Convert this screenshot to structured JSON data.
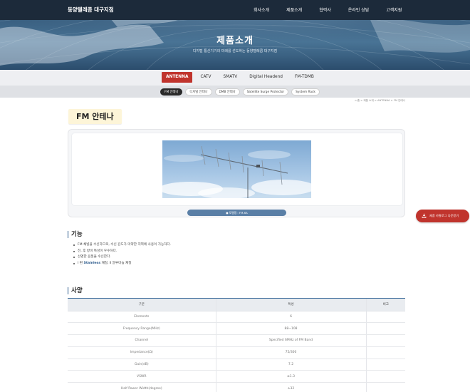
{
  "header": {
    "logo": "동양텔레콤 대구지점",
    "nav": [
      "회사소개",
      "제품소개",
      "협력사",
      "온라인 상담",
      "고객지원"
    ]
  },
  "hero": {
    "title": "제품소개",
    "subtitle": "디지털 통신기기의 미래를 선도하는 동양텔레콤 대구지점"
  },
  "category_tabs": [
    "ANTENNA",
    "CATV",
    "SMATV",
    "Digital Headend",
    "FM-TDMB"
  ],
  "category_active": "ANTENNA",
  "sub_tabs": [
    "FM 안테나",
    "디지털 안테나",
    "DMB 안테나",
    "Satellite Surge Protector",
    "System Rack"
  ],
  "sub_active": "FM 안테나",
  "breadcrumb": "⌂ 홈  >  제품 소개  >  ANTENNA  >  FM 안테나",
  "product": {
    "title": "FM 안테나",
    "model": "● 모델명 : FM-6A"
  },
  "download_button": "제품 카탈로그 다운받기",
  "features": {
    "heading": "기능",
    "items": [
      {
        "text": "FM 채널을 수신하므로, 수신 감도가 미약한 지역에 사용이 가능하다."
      },
      {
        "text": "전, 후 방비 특성이 우수하다."
      },
      {
        "text": "선명한 음질을 수신한다."
      },
      {
        "pre": "Ⅰ 편 ",
        "highlight": "Stainless",
        "post": " 재질, Ⅱ 알루미늄 재질"
      }
    ]
  },
  "spec": {
    "heading": "사양",
    "columns": [
      "구분",
      "특성",
      "비고"
    ],
    "rows": [
      [
        "Elements",
        "6",
        ""
      ],
      [
        "Frequency Range(MHz)",
        "88~108",
        ""
      ],
      [
        "Channel",
        "Specified 6MHz of FM Band",
        ""
      ],
      [
        "Impedance(Ω)",
        "75/300",
        ""
      ],
      [
        "Gain(dB)",
        "7.2",
        ""
      ],
      [
        "VSWR",
        "≤1.3",
        ""
      ],
      [
        "Half Power Width(degree)",
        "±32",
        ""
      ]
    ]
  },
  "colors": {
    "topbar": "#1c2a3a",
    "accent_red": "#c0342d",
    "accent_blue": "#2b5a8c",
    "title_highlight": "#fdf5d8"
  }
}
